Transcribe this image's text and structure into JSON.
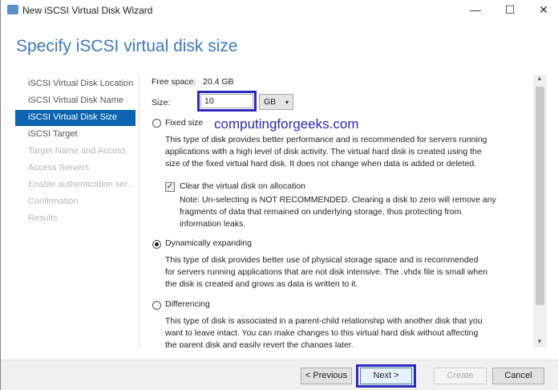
{
  "window": {
    "title": "New iSCSI Virtual Disk Wizard",
    "minimize": "—",
    "maximize": "☐",
    "close": "✕"
  },
  "heading": "Specify iSCSI virtual disk size",
  "nav": [
    "iSCSI Virtual Disk Location",
    "iSCSI Virtual Disk Name",
    "iSCSI Virtual Disk Size",
    "iSCSI Target",
    "Target Name and Access",
    "Access Servers",
    "Enable authentication ser...",
    "Confirmation",
    "Results"
  ],
  "free_space": {
    "label": "Free space:",
    "value": "20.4 GB"
  },
  "size": {
    "label": "Size:",
    "value": "10",
    "unit": "GB"
  },
  "watermark": "computingforgeeks.com",
  "fixed": {
    "label": "Fixed size",
    "desc": "This type of disk provides better performance and is recommended for servers running applications with a high level of disk activity. The virtual hard disk is created using the size of the fixed virtual hard disk. It does not change when data is added or deleted.",
    "clear_label": "Clear the virtual disk on allocation",
    "clear_note": "Note: Un-selecting is NOT RECOMMENDED. Clearing a disk to zero will remove any fragments of data that remained on underlying storage, thus protecting from information leaks."
  },
  "dynamic": {
    "label": "Dynamically expanding",
    "desc": "This type of disk provides better use of physical storage space and is recommended for servers running applications that are not disk intensive. The .vhdx file is small when the disk is created and grows as data is written to it."
  },
  "diff": {
    "label": "Differencing",
    "desc": "This type of disk is associated in a parent-child relationship with another disk that you want to leave intact. You can make changes to this virtual hard disk without affecting the parent disk and easily revert the changes later."
  },
  "buttons": {
    "previous": "< Previous",
    "next": "Next >",
    "create": "Create",
    "cancel": "Cancel"
  }
}
